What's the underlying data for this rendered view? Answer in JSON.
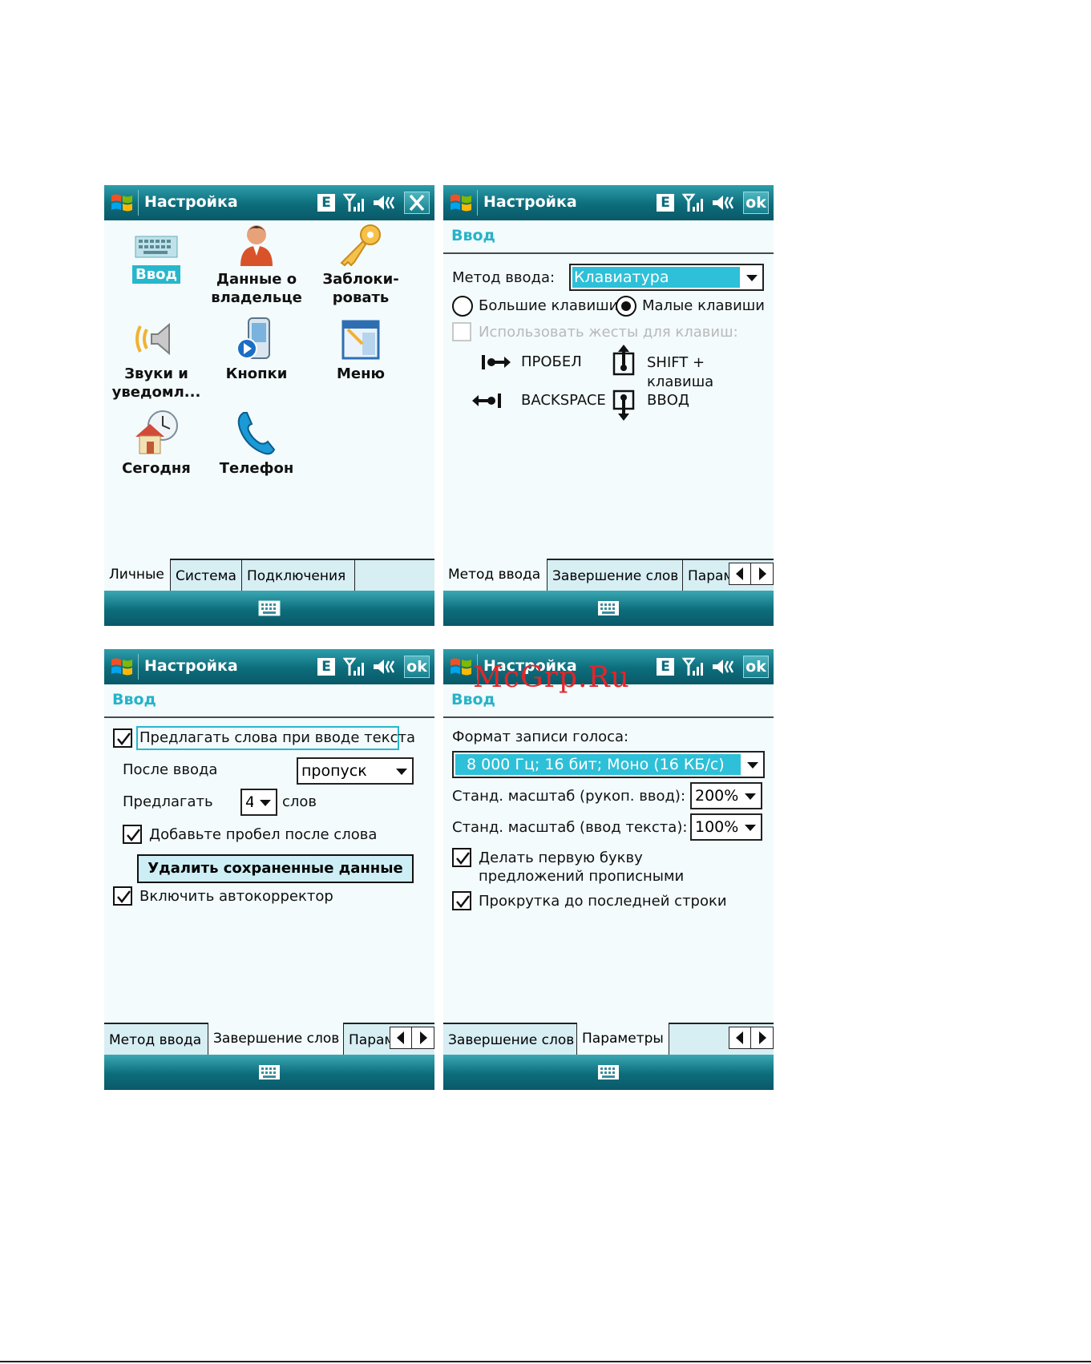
{
  "common": {
    "title": "Настройка",
    "status_e": "E",
    "ok_label": "ok"
  },
  "screen1": {
    "apps": [
      {
        "label": "Ввод",
        "icon": "keyboard-icon"
      },
      {
        "label": "Данные о владельце",
        "icon": "owner-icon"
      },
      {
        "label": "Заблоки-ровать",
        "icon": "key-icon"
      },
      {
        "label": "Звуки и уведомл...",
        "icon": "sounds-icon"
      },
      {
        "label": "Кнопки",
        "icon": "buttons-icon"
      },
      {
        "label": "Меню",
        "icon": "menu-icon"
      },
      {
        "label": "Сегодня",
        "icon": "today-icon"
      },
      {
        "label": "Телефон",
        "icon": "phone-icon"
      }
    ],
    "tabs": [
      "Личные",
      "Система",
      "Подключения"
    ]
  },
  "screen2": {
    "section": "Ввод",
    "method_label": "Метод ввода:",
    "method_value": "Клавиатура",
    "large_keys": "Большие клавиши",
    "small_keys": "Малые клавиши",
    "gestures": "Использовать жесты для клавиш:",
    "g_space": "ПРОБЕЛ",
    "g_shift": "SHIFT + клавиша",
    "g_backspace": "BACKSPACE",
    "g_enter": "ВВОД",
    "tabs": [
      "Метод ввода",
      "Завершение слов",
      "Парам"
    ]
  },
  "screen3": {
    "section": "Ввод",
    "suggest": "Предлагать слова при вводе текста",
    "after_label": "После ввода",
    "after_value": "пропуск",
    "offer_label": "Предлагать",
    "offer_value": "4",
    "words": "слов",
    "add_space": "Добавьте пробел после слова",
    "delete_btn": "Удалить сохраненные данные",
    "autocorrect": "Включить автокорректор",
    "tabs": [
      "Метод ввода",
      "Завершение слов",
      "Парам"
    ]
  },
  "screen4": {
    "section": "Ввод",
    "voice_label": "Формат записи голоса:",
    "voice_value": "8 000 Гц; 16 бит; Моно (16 КБ/с)",
    "hand_label": "Станд. масштаб (рукоп. ввод):",
    "hand_value": "200%",
    "text_label": "Станд. масштаб (ввод текста):",
    "text_value": "100%",
    "capitalize": "Делать первую букву предложений прописными",
    "scroll": "Прокрутка до последней строки",
    "tabs": [
      "Завершение слов",
      "Параметры"
    ]
  },
  "watermark": "McGrp.Ru"
}
